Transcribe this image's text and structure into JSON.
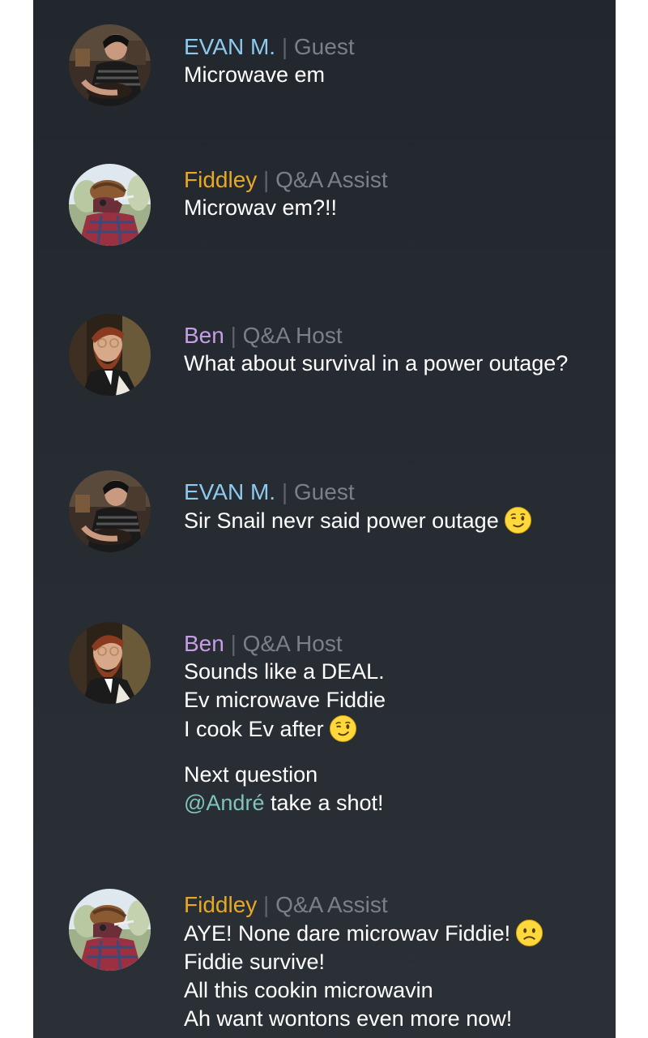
{
  "messages": [
    {
      "user": "EVAN M.",
      "role": "Guest",
      "color": "#8ec9ee",
      "avatar": "evan-avatar",
      "lines": [
        {
          "text": "Microwave em"
        }
      ]
    },
    {
      "user": "Fiddley",
      "role": "Q&A Assist",
      "color": "#e8a826",
      "avatar": "fiddley-avatar",
      "lines": [
        {
          "text": "Microwav em?!!"
        }
      ]
    },
    {
      "user": "Ben",
      "role": "Q&A Host",
      "color": "#c59ee6",
      "avatar": "ben-avatar",
      "lines": [
        {
          "text": "What about survival in a power outage?"
        }
      ]
    },
    {
      "user": "EVAN M.",
      "role": "Guest",
      "color": "#8ec9ee",
      "avatar": "evan-avatar",
      "lines": [
        {
          "text": "Sir Snail nevr said power outage",
          "emoji": "wink-emoji"
        }
      ]
    },
    {
      "user": "Ben",
      "role": "Q&A Host",
      "color": "#c59ee6",
      "avatar": "ben-avatar",
      "lines": [
        {
          "text": "Sounds like a DEAL."
        },
        {
          "text": "Ev microwave Fiddie"
        },
        {
          "text": "I cook Ev after",
          "emoji": "wink-emoji"
        },
        {
          "text": ""
        },
        {
          "text": "Next question"
        },
        {
          "mention": "@André",
          "text": " take a shot!"
        }
      ]
    },
    {
      "user": "Fiddley",
      "role": "Q&A Assist",
      "color": "#e8a826",
      "avatar": "fiddley-avatar",
      "lines": [
        {
          "text": "AYE! None dare microwav Fiddie!",
          "emoji": "frown-emoji"
        },
        {
          "text": "Fiddie survive!"
        },
        {
          "text": "All this cookin microwavin"
        },
        {
          "text": "Ah want wontons even more now!"
        }
      ]
    }
  ],
  "separator": "|"
}
